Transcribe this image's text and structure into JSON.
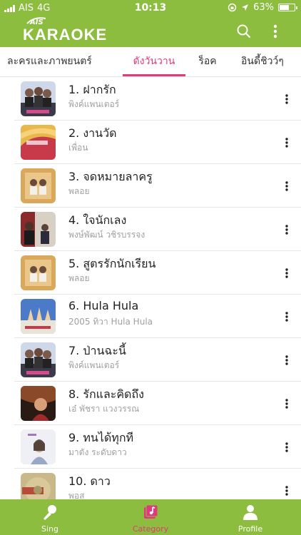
{
  "status_bar": {
    "carrier": "AIS",
    "network": "4G",
    "time": "10:13",
    "battery_percent": "63%",
    "battery_level": 0.63
  },
  "header": {
    "logo_small": "AIS",
    "logo_main": "KARAOKE",
    "icons": [
      "search-icon",
      "more-vertical-icon"
    ]
  },
  "tabs": [
    {
      "label": "ละครและภาพยนตร์",
      "active": false
    },
    {
      "label": "ดังวันวาน",
      "active": true
    },
    {
      "label": "ร็อค",
      "active": false
    },
    {
      "label": "อินดี้ชิวว์ๆ",
      "active": false
    }
  ],
  "songs": [
    {
      "title": "1. ฝากรัก",
      "artist": "พิงค์แพนเตอร์"
    },
    {
      "title": "2. งานวัด",
      "artist": "เพื่อน"
    },
    {
      "title": "3. จดหมายลาครู",
      "artist": "พลอย"
    },
    {
      "title": "4. ใจนักเลง",
      "artist": "พงษ์พัฒน์ วชิรบรรจง"
    },
    {
      "title": "5. สูตรรักนักเรียน",
      "artist": "พลอย"
    },
    {
      "title": "6. Hula Hula",
      "artist": "2005 ทิวา Hula Hula"
    },
    {
      "title": "7. ป่านฉะนี้",
      "artist": "พิงค์แพนเตอร์"
    },
    {
      "title": "8. รักและคิดถึง",
      "artist": "เอ๋ พัชรา แวงวรรณ"
    },
    {
      "title": "9. ทนได้ทุกที",
      "artist": "มาตัง ระดับดาว"
    },
    {
      "title": "10. ดาว",
      "artist": "พอส"
    }
  ],
  "bottom_nav": [
    {
      "label": "Sing",
      "icon": "microphone-icon",
      "active": false
    },
    {
      "label": "Category",
      "icon": "music-library-icon",
      "active": true
    },
    {
      "label": "Profile",
      "icon": "profile-icon",
      "active": false
    }
  ],
  "colors": {
    "brand_green": "#8cbd3f",
    "accent_pink": "#e03a7c"
  }
}
